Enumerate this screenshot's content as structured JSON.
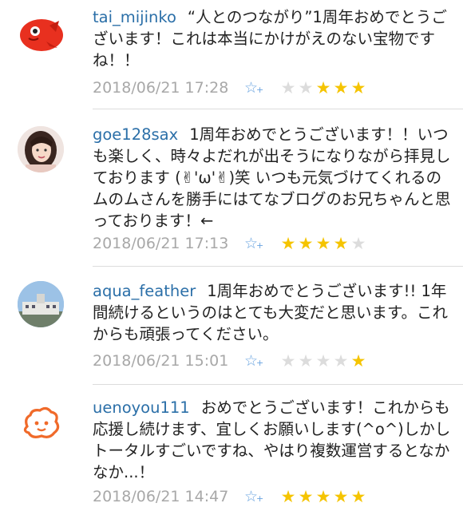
{
  "colors": {
    "username": "#2b6fa8",
    "timestamp": "#a8a8a8",
    "star_on": "#f5c400",
    "star_off": "#dcdcdc",
    "add_star": "#6aa4e0"
  },
  "comments": [
    {
      "user": "tai_mijinko",
      "text": "“人とのつながり”1周年おめでとうございます！これは本当にかけがえのない宝物ですね！！",
      "timestamp": "2018/06/21 17:28",
      "avatar_icon": "red-fish-icon",
      "stars": 3,
      "max_stars": 5
    },
    {
      "user": "goe128sax",
      "text": "1周年おめでとうございます！！いつも楽しく、時々よだれが出そうになりながら拝見しております (✌'ω'✌)笑 いつも元気づけてくれるのムのムさんを勝手にはてなブログのお兄ちゃんと思っております！←",
      "timestamp": "2018/06/21 17:13",
      "avatar_icon": "user-photo-avatar",
      "stars": 4,
      "max_stars": 5
    },
    {
      "user": "aqua_feather",
      "text": "1周年おめでとうございます!! 1年間続けるというのはとても大変だと思います。これからも頑張ってください。",
      "timestamp": "2018/06/21 15:01",
      "avatar_icon": "building-photo-avatar",
      "stars": 1,
      "max_stars": 5
    },
    {
      "user": "uenoyou111",
      "text": "おめでとうございます！これからも応援し続けます、宜しくお願いします(^o^)しかしトータルすごいですね、やはり複数運営するとなかなか...！",
      "timestamp": "2018/06/21 14:47",
      "avatar_icon": "orange-face-icon",
      "stars": 5,
      "max_stars": 5
    }
  ]
}
